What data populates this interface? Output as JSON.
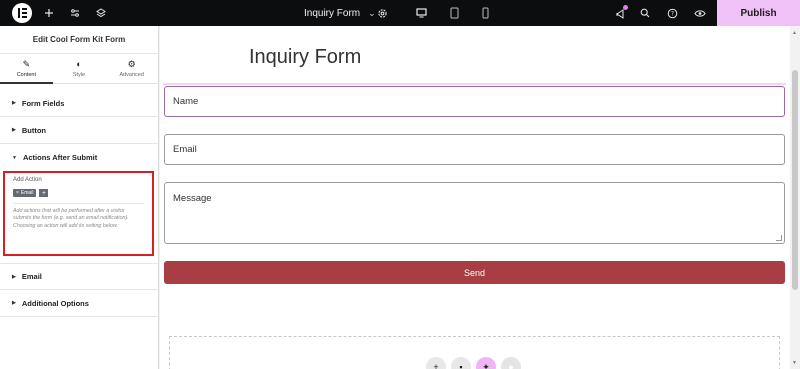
{
  "topbar": {
    "page_title": "Inquiry Form",
    "publish_label": "Publish",
    "icons": [
      "elementor-logo-icon",
      "add-icon",
      "settings-sliders-icon",
      "layers-icon",
      "chevron-down-icon",
      "gear-icon",
      "desktop-icon",
      "tablet-icon",
      "mobile-icon",
      "announcement-icon",
      "search-icon",
      "help-icon",
      "preview-eye-icon"
    ]
  },
  "sidebar": {
    "title": "Edit Cool Form Kit Form",
    "tabs": [
      {
        "label": "Content",
        "icon": "pencil-icon",
        "active": true
      },
      {
        "label": "Style",
        "icon": "contrast-icon",
        "active": false
      },
      {
        "label": "Advanced",
        "icon": "gear-icon",
        "active": false
      }
    ],
    "sections": {
      "form_fields": "Form Fields",
      "button": "Button",
      "actions_after_submit": "Actions After Submit",
      "email": "Email",
      "additional_options": "Additional Options"
    },
    "actions": {
      "add_action_label": "Add Action",
      "tag": "Email",
      "tag_remove": "×",
      "add_symbol": "+",
      "help_text": "Add actions that will be performed after a visitor submits the form (e.g. send an email notification). Choosing an action will add its setting below."
    }
  },
  "canvas": {
    "heading": "Inquiry Form",
    "fields": {
      "name_placeholder": "Name",
      "email_placeholder": "Email",
      "message_placeholder": "Message"
    },
    "send_label": "Send"
  },
  "colors": {
    "topbar_bg": "#0c0d0e",
    "publish_bg": "#f0c1f6",
    "send_bg": "#a83d43",
    "highlight_border": "#d81f26"
  }
}
